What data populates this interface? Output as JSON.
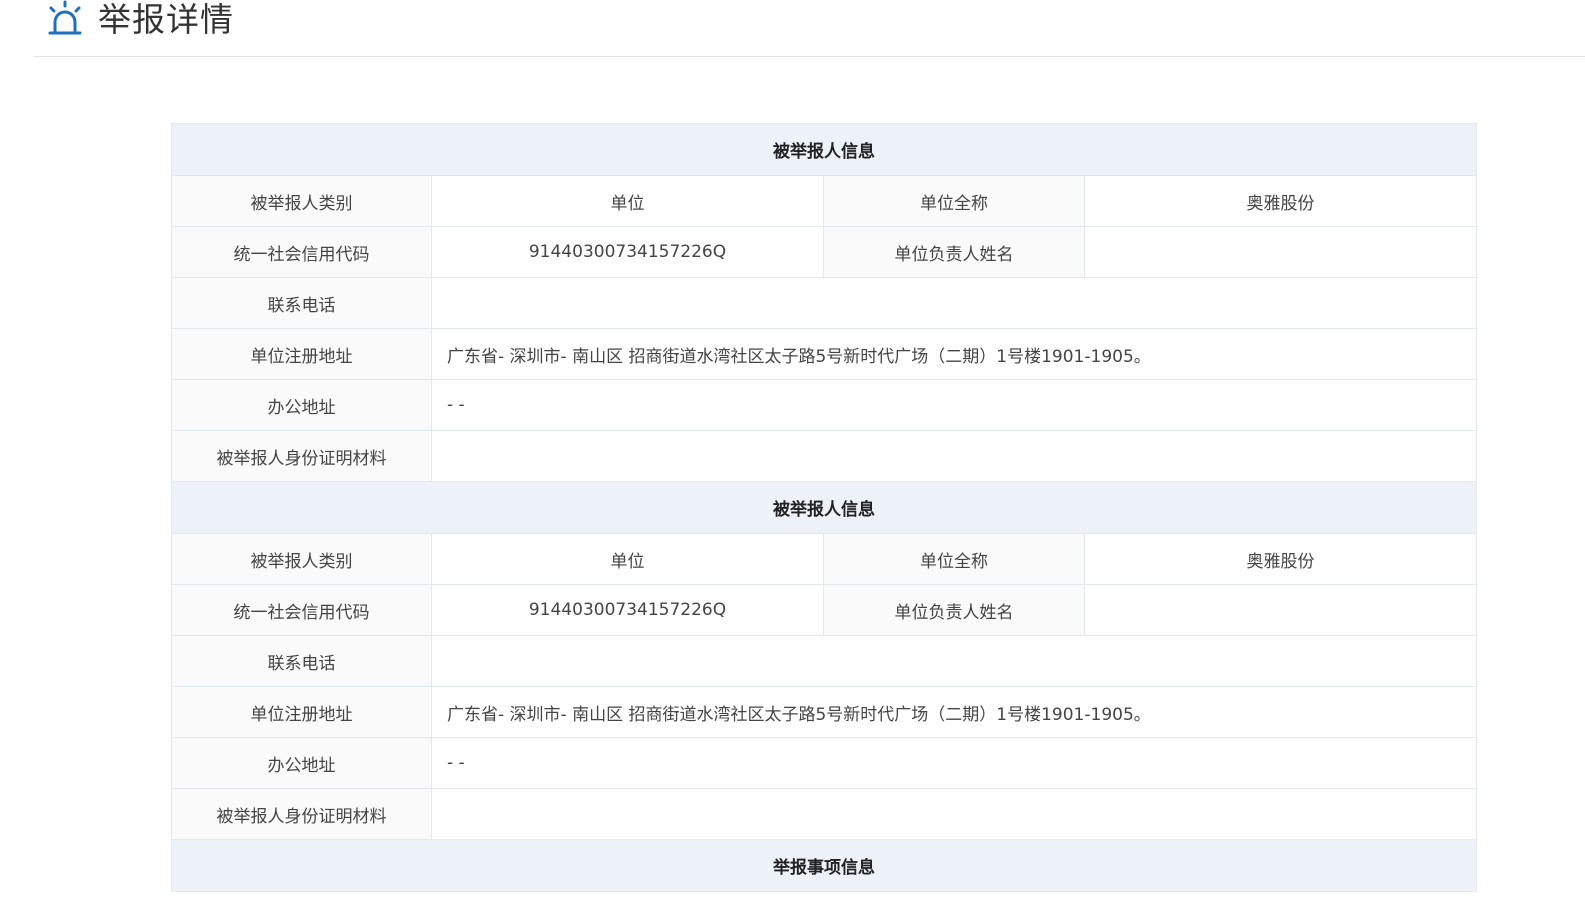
{
  "page": {
    "title": "举报详情",
    "icon": "alarm-light-icon",
    "accent_color": "#1e6fbf"
  },
  "sections": [
    {
      "header": "被举报人信息",
      "type_label": "被举报人类别",
      "type_value": "单位",
      "name_label": "单位全称",
      "name_value": "奥雅股份",
      "credit_code_label": "统一社会信用代码",
      "credit_code_value": "91440300734157226Q",
      "leader_label": "单位负责人姓名",
      "leader_value": "",
      "phone_label": "联系电话",
      "phone_value": "",
      "reg_address_label": "单位注册地址",
      "reg_address_value": "广东省- 深圳市- 南山区 招商街道水湾社区太子路5号新时代广场（二期）1号楼1901-1905。",
      "office_address_label": "办公地址",
      "office_address_value": "- -",
      "id_material_label": "被举报人身份证明材料",
      "id_material_value": ""
    },
    {
      "header": "被举报人信息",
      "type_label": "被举报人类别",
      "type_value": "单位",
      "name_label": "单位全称",
      "name_value": "奥雅股份",
      "credit_code_label": "统一社会信用代码",
      "credit_code_value": "91440300734157226Q",
      "leader_label": "单位负责人姓名",
      "leader_value": "",
      "phone_label": "联系电话",
      "phone_value": "",
      "reg_address_label": "单位注册地址",
      "reg_address_value": "广东省- 深圳市- 南山区 招商街道水湾社区太子路5号新时代广场（二期）1号楼1901-1905。",
      "office_address_label": "办公地址",
      "office_address_value": "- -",
      "id_material_label": "被举报人身份证明材料",
      "id_material_value": ""
    }
  ],
  "report_section": {
    "header": "举报事项信息"
  }
}
